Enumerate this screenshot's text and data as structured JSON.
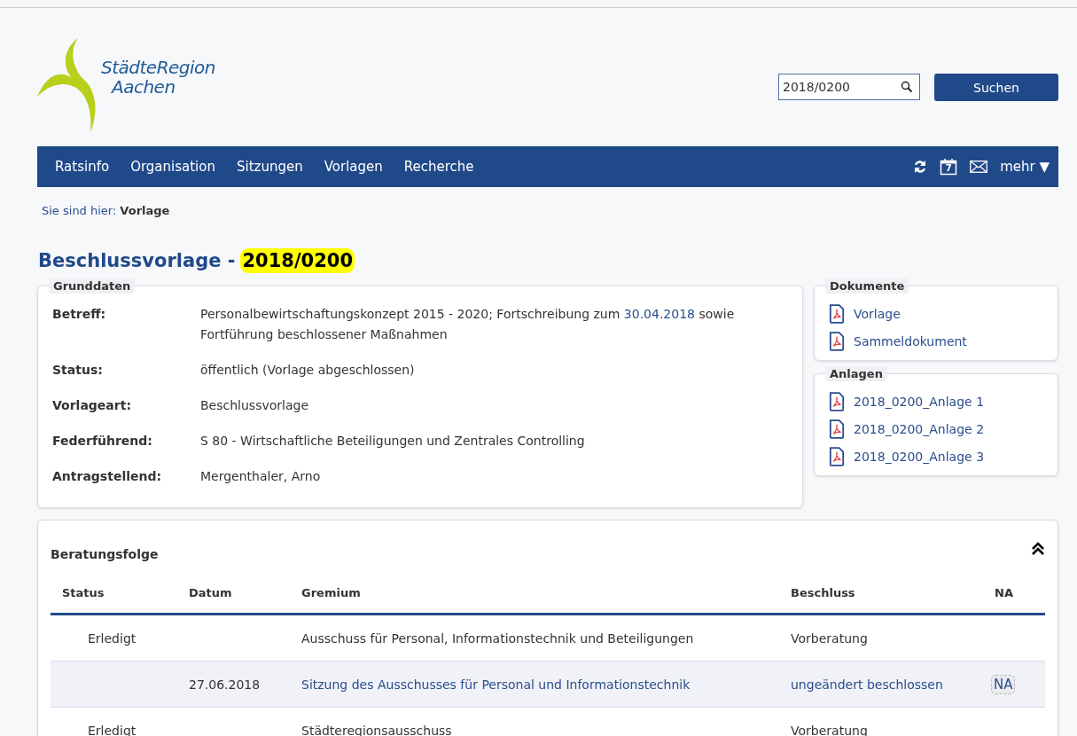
{
  "logo": {
    "line_1": "StädteRegion",
    "line_2": "Aachen"
  },
  "search": {
    "value": "2018/0200",
    "button": "Suchen"
  },
  "nav": {
    "items": [
      {
        "label": "Ratsinfo"
      },
      {
        "label": "Organisation"
      },
      {
        "label": "Sitzungen"
      },
      {
        "label": "Vorlagen"
      },
      {
        "label": "Recherche"
      }
    ],
    "calendar_day": "7",
    "more": "mehr ▼"
  },
  "breadcrumb": {
    "label": "Sie sind hier:",
    "current": "Vorlage"
  },
  "title": {
    "prefix": "Beschlussvorlage -",
    "number": "2018/0200"
  },
  "grunddaten": {
    "legend": "Grunddaten",
    "fields": [
      {
        "label": "Betreff:",
        "value": [
          {
            "text": "Personalbewirtschaftungskonzept 2015 - 2020; Fortschreibung zum ",
            "kind": "text"
          },
          {
            "text": "30.04.2018",
            "kind": "link"
          },
          {
            "text": " sowie Fortführung beschlossener Maßnahmen",
            "kind": "text"
          }
        ]
      },
      {
        "label": "Status:",
        "value": [
          {
            "text": "öffentlich (Vorlage abgeschlossen)",
            "kind": "text"
          }
        ]
      },
      {
        "label": "Vorlageart:",
        "value": [
          {
            "text": "Beschlussvorlage",
            "kind": "text"
          }
        ]
      },
      {
        "label": "Federführend:",
        "value": [
          {
            "text": "S 80 - Wirtschaftliche Beteiligungen und Zentrales Controlling",
            "kind": "text"
          }
        ]
      },
      {
        "label": "Antragstellend:",
        "value": [
          {
            "text": "Mergenthaler, Arno",
            "kind": "text"
          }
        ]
      }
    ]
  },
  "dokumente": {
    "legend": "Dokumente",
    "items": [
      "Vorlage",
      "Sammeldokument"
    ]
  },
  "anlagen": {
    "legend": "Anlagen",
    "items": [
      "2018_0200_Anlage 1",
      "2018_0200_Anlage 2",
      "2018_0200_Anlage 3"
    ]
  },
  "beratungsfolge": {
    "title": "Beratungsfolge",
    "expanded": true,
    "columns": [
      "Status",
      "Datum",
      "Gremium",
      "Beschluss",
      "NA"
    ],
    "rows": [
      {
        "kind": "gremium",
        "status": "Erledigt",
        "gremium": "Ausschuss für Personal, Informationstechnik und Beteiligungen",
        "beschluss": "Vorberatung"
      },
      {
        "kind": "sitzung",
        "datum": "27.06.2018",
        "gremium": "Sitzung des Ausschusses für Personal und Informationstechnik",
        "beschluss": "ungeändert beschlossen",
        "na": "NA"
      },
      {
        "kind": "gremium",
        "status": "Erledigt",
        "gremium": "Städteregionsausschuss",
        "beschluss": "Vorberatung"
      }
    ]
  }
}
